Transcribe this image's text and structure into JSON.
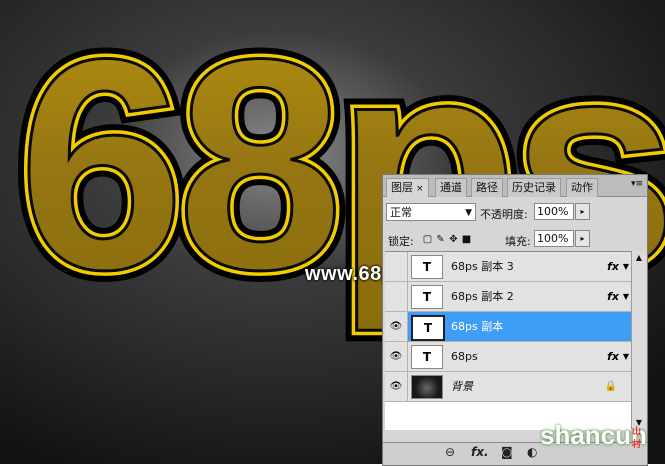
{
  "artwork": {
    "headline": "68ps",
    "colors": {
      "gold": "#9c7c10",
      "highlight": "#f4d200",
      "stroke": "#050505",
      "background": "#222222"
    }
  },
  "watermark": "www.68ps.com",
  "panel": {
    "tabs": [
      {
        "label": "图层",
        "close": "×",
        "active": true
      },
      {
        "label": "通道"
      },
      {
        "label": "路径"
      },
      {
        "label": "历史记录"
      },
      {
        "label": "动作"
      }
    ],
    "menu_icon": "panel-menu-icon",
    "blend_mode": "正常",
    "opacity_label": "不透明度:",
    "opacity_value": "100%",
    "lock_label": "锁定:",
    "fill_label": "填充:",
    "fill_value": "100%",
    "layers": [
      {
        "name": "68ps 副本 3",
        "type": "text",
        "thumb": "T",
        "visible": false,
        "fx": "fx",
        "selected": false
      },
      {
        "name": "68ps 副本 2",
        "type": "text",
        "thumb": "T",
        "visible": false,
        "fx": "fx",
        "selected": false
      },
      {
        "name": "68ps 副本",
        "type": "text",
        "thumb": "T",
        "visible": true,
        "fx": "",
        "selected": true
      },
      {
        "name": "68ps",
        "type": "text",
        "thumb": "T",
        "visible": true,
        "fx": "fx",
        "selected": false
      },
      {
        "name": "背景",
        "type": "background",
        "thumb": "",
        "visible": true,
        "fx": "",
        "selected": false,
        "locked": true
      }
    ],
    "bottom_icons": [
      "link-icon",
      "fx-icon",
      "mask-icon",
      "adjustment-icon",
      "folder-icon",
      "new-layer-icon",
      "trash-icon"
    ]
  },
  "site_watermark": {
    "text": "shancun",
    "tag": "山村"
  }
}
